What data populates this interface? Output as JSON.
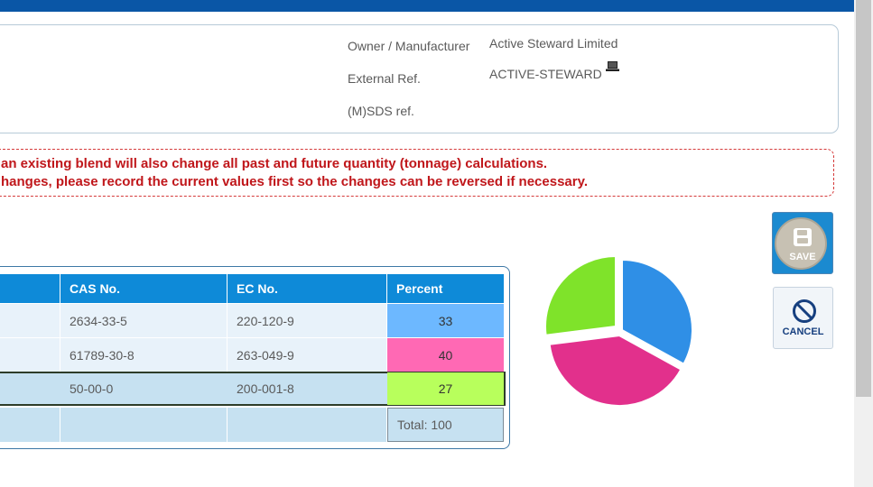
{
  "info": {
    "owner_label": "Owner / Manufacturer",
    "owner_value": "Active Steward Limited",
    "owner_icon": "laptop-icon",
    "external_ref_label": "External Ref.",
    "external_ref_value": "ACTIVE-STEWARD",
    "msds_label": "(M)SDS ref."
  },
  "warning": {
    "line1": "an existing blend will also change all past and future quantity (tonnage) calculations.",
    "line2": "hanges, please record the current values first so the changes can be reversed if necessary."
  },
  "table": {
    "headers": {
      "cas": "CAS No.",
      "ec": "EC No.",
      "percent": "Percent"
    },
    "rows": [
      {
        "cas": "2634-33-5",
        "ec": "220-120-9",
        "percent": "33",
        "color": "#6db8ff"
      },
      {
        "cas": "61789-30-8",
        "ec": "263-049-9",
        "percent": "40",
        "color": "#ff69b4"
      },
      {
        "cas": "50-00-0",
        "ec": "200-001-8",
        "percent": "27",
        "color": "#b8ff5c"
      }
    ],
    "total": "Total: 100"
  },
  "buttons": {
    "save_label": "SAVE",
    "cancel_label": "CANCEL"
  },
  "chart_data": {
    "type": "pie",
    "title": "",
    "values": [
      33,
      40,
      27
    ],
    "colors": [
      "#2f8fe6",
      "#e2308c",
      "#7fe32a"
    ]
  }
}
